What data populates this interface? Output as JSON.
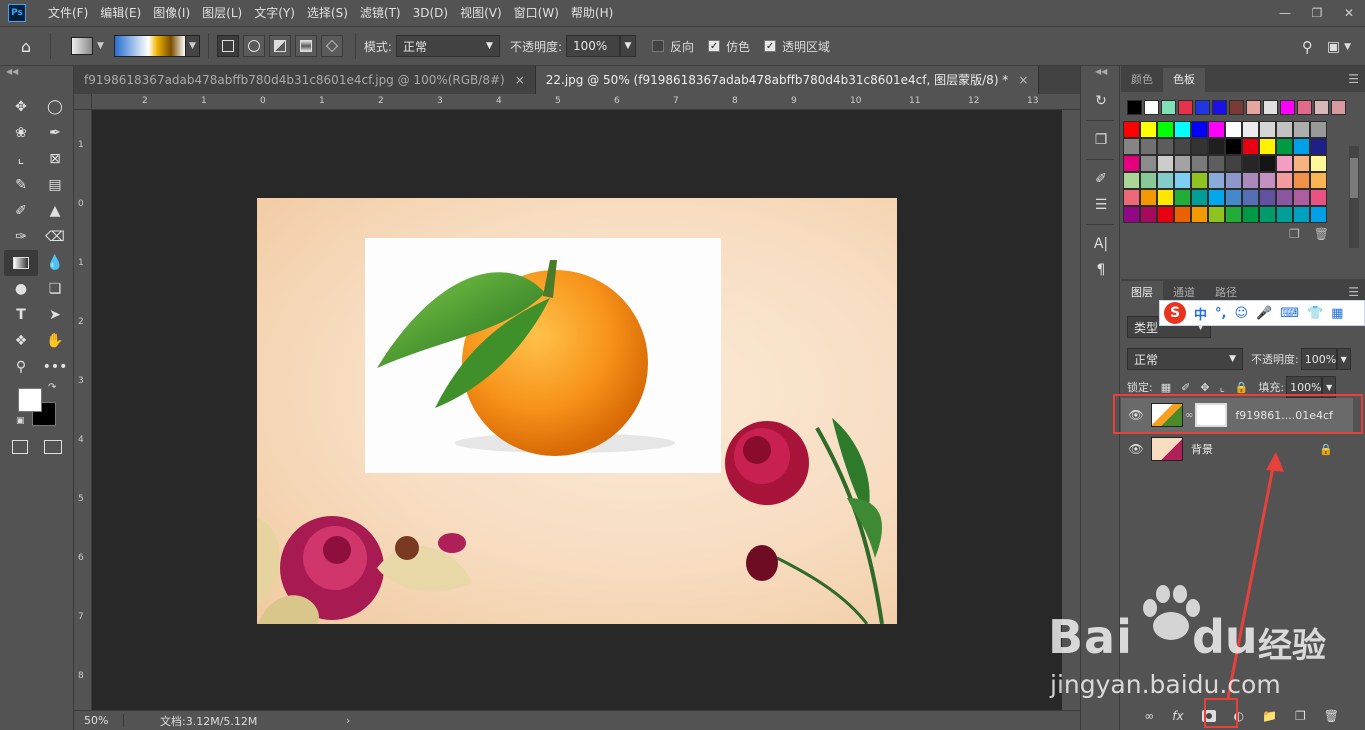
{
  "menu": {
    "items": [
      "文件(F)",
      "编辑(E)",
      "图像(I)",
      "图层(L)",
      "文字(Y)",
      "选择(S)",
      "滤镜(T)",
      "3D(D)",
      "视图(V)",
      "窗口(W)",
      "帮助(H)"
    ]
  },
  "app_logo": "Ps",
  "options": {
    "mode_label": "模式:",
    "mode_value": "正常",
    "opacity_label": "不透明度:",
    "opacity_value": "100%",
    "reverse_label": "反向",
    "dither_label": "仿色",
    "transparency_label": "透明区域"
  },
  "tabs": [
    {
      "label": "f9198618367adab478abffb780d4b31c8601e4cf.jpg @ 100%(RGB/8#)"
    },
    {
      "label": "22.jpg @ 50% (f9198618367adab478abffb780d4b31c8601e4cf, 图层蒙版/8) *"
    }
  ],
  "ruler_h": [
    "2",
    "1",
    "0",
    "1",
    "2",
    "3",
    "4",
    "5",
    "6",
    "7",
    "8",
    "9",
    "10",
    "11",
    "12",
    "13"
  ],
  "ruler_v": [
    "1",
    "0",
    "1",
    "2",
    "3",
    "4",
    "5",
    "6",
    "7",
    "8"
  ],
  "status": {
    "zoom": "50%",
    "doc_info": "文档:3.12M/5.12M"
  },
  "swatches_panel": {
    "tabs": [
      "颜色",
      "色板"
    ],
    "recent": [
      "#000000",
      "#ffffff",
      "#7fe0b7",
      "#e8314a",
      "#1f36e0",
      "#1c10e8",
      "#7a3a36",
      "#e6a6a0",
      "#e0e0e0",
      "#ff00ff",
      "#e06a8a",
      "#d8b8b8",
      "#d89aa0"
    ],
    "grid": [
      "#ff0000",
      "#ffff00",
      "#00ff00",
      "#00ffff",
      "#0000ff",
      "#ff00ff",
      "#ffffff",
      "#ebebeb",
      "#d6d6d6",
      "#c2c2c2",
      "#adadad",
      "#999999",
      "#858585",
      "#707070",
      "#5c5c5c",
      "#474747",
      "#333333",
      "#1f1f1f",
      "#000000",
      "#e60012",
      "#fff100",
      "#009944",
      "#00a0e9",
      "#1d2088",
      "#e4007f",
      "#8c8c8c",
      "#cccccc",
      "#a3a3a3",
      "#7a7a7a",
      "#5e5e5e",
      "#424242",
      "#262626",
      "#141414",
      "#f19ec2",
      "#f6b37f",
      "#fff799",
      "#acd598",
      "#89c997",
      "#84ccc9",
      "#7ecef4",
      "#8fc31f",
      "#88abda",
      "#8c97cb",
      "#aa89bd",
      "#c490bf",
      "#f29c9f",
      "#f19149",
      "#f8b551",
      "#eb6877",
      "#f39800",
      "#ffe600",
      "#22ac38",
      "#009e96",
      "#00a7ea",
      "#448aca",
      "#556fb5",
      "#5f52a0",
      "#8957a1",
      "#ae5da1",
      "#e95384",
      "#920783",
      "#a40b5d",
      "#e60012",
      "#eb6100",
      "#f39800",
      "#8fc31f",
      "#22ac38",
      "#009944",
      "#009b6b",
      "#009e96",
      "#00a0c1",
      "#00a0e9"
    ]
  },
  "layers_panel": {
    "tabs": [
      "图层",
      "通道",
      "路径"
    ],
    "filter_label": "类型",
    "blend_mode": "正常",
    "opacity_label": "不透明度:",
    "opacity_value": "100%",
    "lock_label": "锁定:",
    "fill_label": "填充:",
    "fill_value": "100%",
    "layers": [
      {
        "name": "f919861....01e4cf"
      },
      {
        "name": "背景"
      }
    ]
  },
  "ime": {
    "label": "中"
  },
  "watermark": {
    "brand": "Bai",
    "brand2": "经验",
    "url": "jingyan.baidu.com"
  },
  "colors": {
    "accent_red": "#e8403a"
  }
}
